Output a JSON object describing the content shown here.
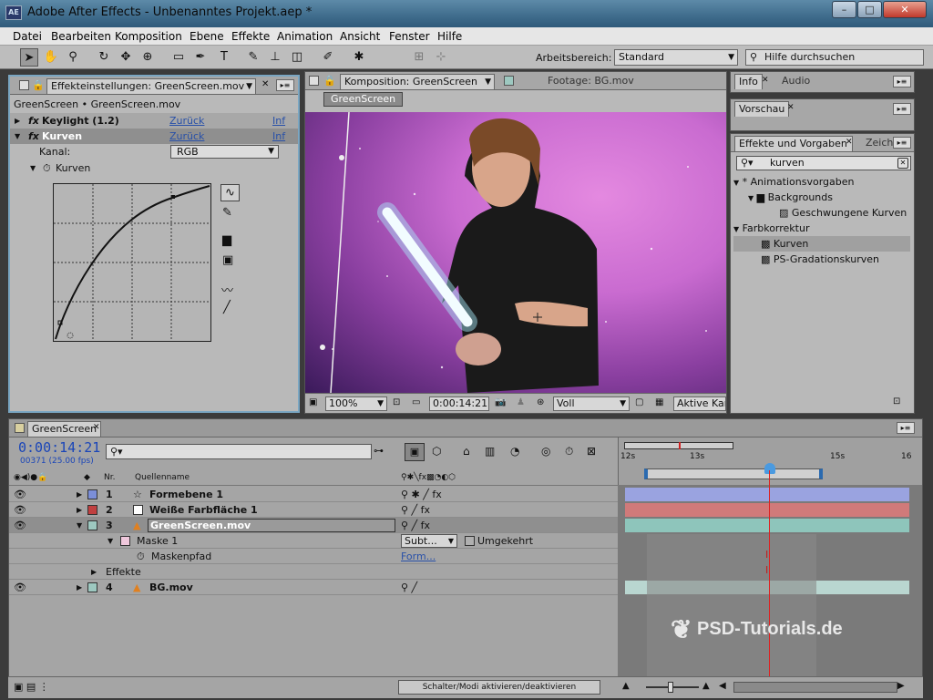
{
  "titlebar": {
    "app_icon": "AE",
    "title": "Adobe After Effects - Unbenanntes Projekt.aep *",
    "min": "–",
    "max": "□",
    "close": "✕"
  },
  "menu": [
    "Datei",
    "Bearbeiten",
    "Komposition",
    "Ebene",
    "Effekte",
    "Animation",
    "Ansicht",
    "Fenster",
    "Hilfe"
  ],
  "toolbar": {
    "workspace_label": "Arbeitsbereich:",
    "workspace_value": "Standard",
    "help_placeholder": "Hilfe durchsuchen"
  },
  "fx_panel": {
    "tab": "Effekteinstellungen: GreenScreen.mov",
    "breadcrumb": "GreenScreen • GreenScreen.mov",
    "effects": [
      {
        "name": "Keylight (1.2)",
        "reset": "Zurück",
        "info": "Inf"
      },
      {
        "name": "Kurven",
        "reset": "Zurück",
        "info": "Inf"
      }
    ],
    "channel_label": "Kanal:",
    "channel_value": "RGB",
    "curves_label": "Kurven"
  },
  "comp_panel": {
    "tab1": "Komposition: GreenScreen",
    "tab2": "Footage: BG.mov",
    "comp_button": "GreenScreen",
    "zoom": "100%",
    "timecode": "0:00:14:21",
    "quality": "Voll",
    "camera": "Aktive Kar"
  },
  "right_panels": {
    "info_tab": "Info",
    "audio_tab": "Audio",
    "preview_tab": "Vorschau",
    "effects_tab": "Effekte und Vorgaben",
    "char_tab": "Zeich",
    "search_value": "kurven",
    "tree": [
      {
        "label": "* Animationsvorgaben",
        "level": 0
      },
      {
        "label": "Backgrounds",
        "level": 1
      },
      {
        "label": "Geschwungene Kurven",
        "level": 2
      },
      {
        "label": "Farbkorrektur",
        "level": 0
      },
      {
        "label": "Kurven",
        "level": 1
      },
      {
        "label": "PS-Gradationskurven",
        "level": 1
      }
    ]
  },
  "timeline": {
    "tab": "GreenScreen",
    "timecode": "0:00:14:21",
    "frames": "00371 (25.00 fps)",
    "col_nr": "Nr.",
    "col_source": "Quellenname",
    "ruler": [
      "12s",
      "13s",
      "15s",
      "16"
    ],
    "layers": [
      {
        "nr": "1",
        "name": "Formebene 1",
        "color": "#7b8ed8",
        "bar": "#9aa3e0"
      },
      {
        "nr": "2",
        "name": "Weiße Farbfläche 1",
        "color": "#c04040",
        "bar": "#d07a7a"
      },
      {
        "nr": "3",
        "name": "GreenScreen.mov",
        "color": "#9dc8c0",
        "bar": "#8ec5bb"
      },
      {
        "nr": "4",
        "name": "BG.mov",
        "color": "#9dc8c0",
        "bar": "#b9d6d0"
      }
    ],
    "mask_label": "Maske 1",
    "mask_mode": "Subt...",
    "mask_inverted": "Umgekehrt",
    "mask_path": "Maskenpfad",
    "mask_path_value": "Form...",
    "effects_label": "Effekte",
    "toggle_modes": "Schalter/Modi aktivieren/deaktivieren"
  },
  "watermark": "PSD-Tutorials.de"
}
